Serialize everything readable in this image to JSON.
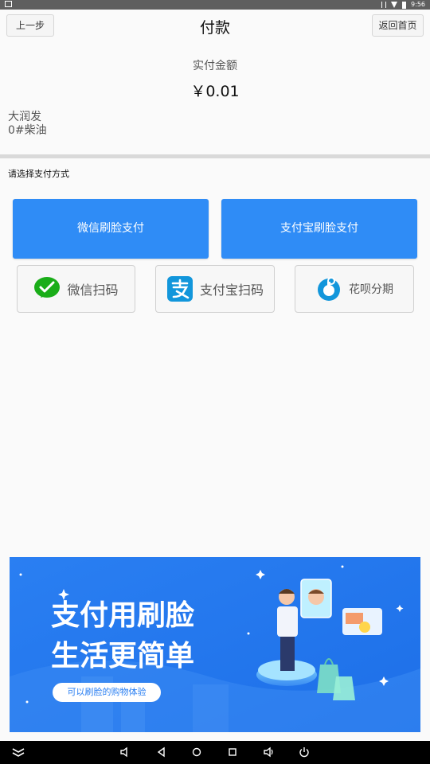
{
  "status_bar": {
    "time": "9:56"
  },
  "header": {
    "back_label": "上一步",
    "title": "付款",
    "home_label": "返回首页"
  },
  "payment": {
    "amount_label": "实付金额",
    "amount_value": "￥0.01",
    "merchant": "大润发",
    "product": "0#柴油"
  },
  "methods": {
    "prompt": "请选择支付方式",
    "wechat_face": "微信刷脸支付",
    "alipay_face": "支付宝刷脸支付",
    "wechat_scan": "微信扫码",
    "alipay_scan": "支付宝扫码",
    "huabei": "花呗分期"
  },
  "banner": {
    "line1": "支付用刷脸",
    "line2": "生活更简单",
    "tag": "可以刷脸的购物体验"
  },
  "colors": {
    "accent": "#2f8cf6",
    "wechat_green": "#1aad19",
    "alipay_blue": "#1296db",
    "banner_blue": "#2478f0"
  }
}
